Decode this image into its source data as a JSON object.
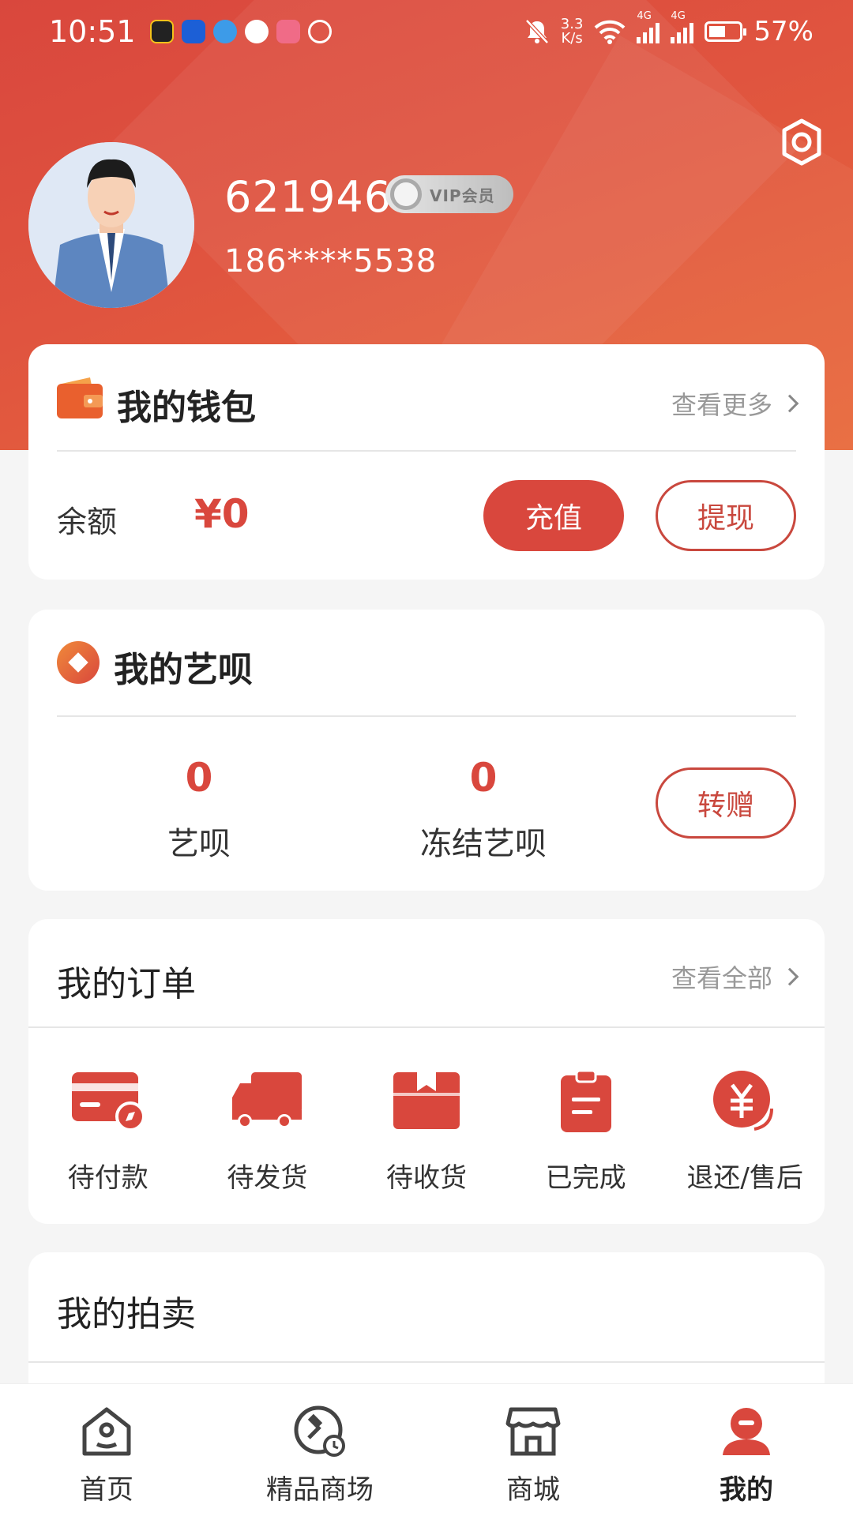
{
  "status_bar": {
    "time": "10:51",
    "network_speed_value": "3.3",
    "network_speed_unit": "K/s",
    "network_1": "4G",
    "network_2": "4G",
    "battery": "57%"
  },
  "profile": {
    "user_id": "621946",
    "vip_label": "VIP会员",
    "phone": "186****5538"
  },
  "wallet": {
    "title": "我的钱包",
    "more_label": "查看更多",
    "balance_label": "余额",
    "balance_value": "¥0",
    "recharge_label": "充值",
    "withdraw_label": "提现"
  },
  "yibei": {
    "title": "我的艺呗",
    "available_value": "0",
    "available_label": "艺呗",
    "frozen_value": "0",
    "frozen_label": "冻结艺呗",
    "transfer_label": "转赠"
  },
  "orders": {
    "title": "我的订单",
    "more_label": "查看全部",
    "items": [
      {
        "label": "待付款",
        "icon": "card-pay-icon"
      },
      {
        "label": "待发货",
        "icon": "truck-icon"
      },
      {
        "label": "待收货",
        "icon": "package-icon"
      },
      {
        "label": "已完成",
        "icon": "clipboard-icon"
      },
      {
        "label": "退还/售后",
        "icon": "yen-refund-icon"
      }
    ]
  },
  "auction": {
    "title": "我的拍卖"
  },
  "tabbar": {
    "items": [
      {
        "label": "首页",
        "icon": "home-icon"
      },
      {
        "label": "精品商场",
        "icon": "auction-hammer-icon"
      },
      {
        "label": "商城",
        "icon": "store-icon"
      },
      {
        "label": "我的",
        "icon": "person-icon"
      }
    ],
    "active_index": 3
  },
  "colors": {
    "accent": "#d9473d",
    "header_gradient_start": "#d9473d",
    "header_gradient_end": "#e8693a"
  }
}
